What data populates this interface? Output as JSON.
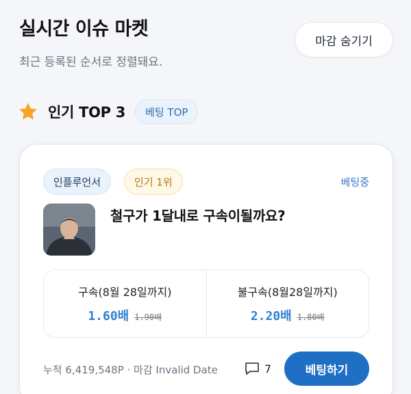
{
  "header": {
    "title": "실시간 이슈 마켓",
    "subtitle": "최근 등록된 순서로 정렬돼요.",
    "hide_button": "마감 숨기기"
  },
  "section": {
    "icon": "star-icon",
    "title": "인기 TOP 3",
    "pill": "베팅 TOP"
  },
  "card": {
    "tags": [
      "인플루언서",
      "인기 1위"
    ],
    "status": "베팅중",
    "question": "철구가 1달내로 구속이될까요?",
    "options": [
      {
        "label": "구속(8월 28일까지)",
        "odds": "1.60배",
        "old_odds": "1.90배"
      },
      {
        "label": "불구속(8월28일까지)",
        "odds": "2.20배",
        "old_odds": "1.80배"
      }
    ],
    "meta": "누적 6,419,548P · 마감 Invalid Date",
    "comment_count": "7",
    "bet_button": "베팅하기"
  },
  "colors": {
    "accent": "#1f6fc4",
    "odds": "#2f80d0",
    "star": "#f5a623",
    "tag_gold": "#b07a10"
  }
}
